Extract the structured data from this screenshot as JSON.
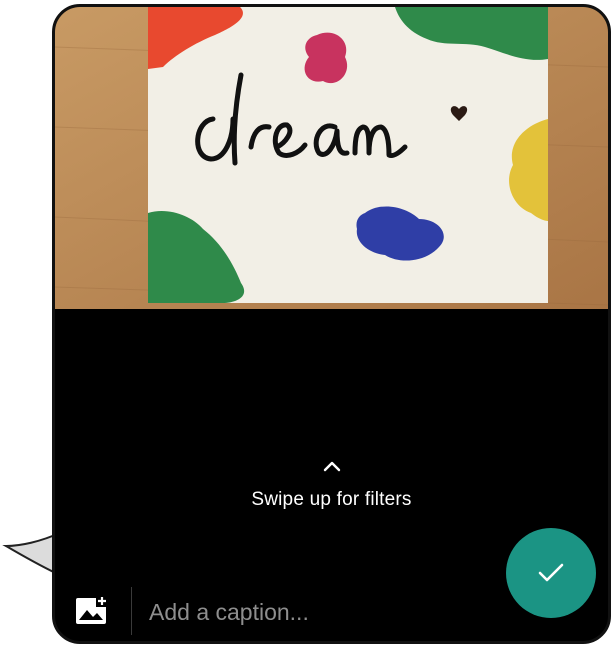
{
  "image": {
    "handwritten_word": "dream",
    "colors": {
      "table": "#b98552",
      "canvas": "#f2efe6",
      "red": "#e8492f",
      "magenta": "#c8335f",
      "green": "#2f8a4a",
      "yellow": "#e3c23a",
      "blue": "#2f3ea6",
      "ink": "#111111"
    }
  },
  "filters_hint": {
    "icon": "chevron-up-icon",
    "text": "Swipe up for filters"
  },
  "caption": {
    "placeholder": "Add a caption...",
    "value": ""
  },
  "actions": {
    "gallery_icon": "add-photo-icon",
    "send_icon": "check-icon",
    "send_color": "#1b9484"
  }
}
